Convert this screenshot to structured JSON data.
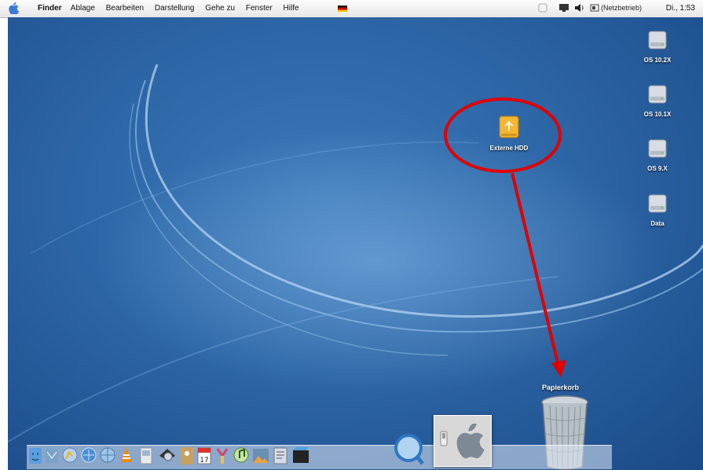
{
  "menubar": {
    "app_name": "Finder",
    "menus": [
      "Ablage",
      "Bearbeiten",
      "Darstellung",
      "Gehe zu",
      "Fenster",
      "Hilfe"
    ],
    "network_status": "(Netzbetrieb)",
    "clock": "Di., 1:53"
  },
  "desktop": {
    "disks": [
      {
        "label": "OS 10.2X"
      },
      {
        "label": "OS 10.1X"
      },
      {
        "label": "OS 9.X"
      },
      {
        "label": "Data"
      }
    ],
    "external_drive": {
      "label": "Externe HDD"
    },
    "trash": {
      "label": "Papierkorb"
    },
    "annotation": {
      "highlight_color": "#e00000",
      "arrow_color": "#e00000"
    }
  },
  "dock": {
    "items": [
      "finder",
      "mail",
      "ichat",
      "safari",
      "network",
      "vlc",
      "preview",
      "spotlight",
      "address-book",
      "ical",
      "calculator",
      "itunes",
      "iphoto",
      "quicktime-list",
      "imovie",
      "quicktime"
    ]
  },
  "colors": {
    "desktop_blue": "#2d66a6",
    "menubar_bg": "#eeeeee"
  }
}
